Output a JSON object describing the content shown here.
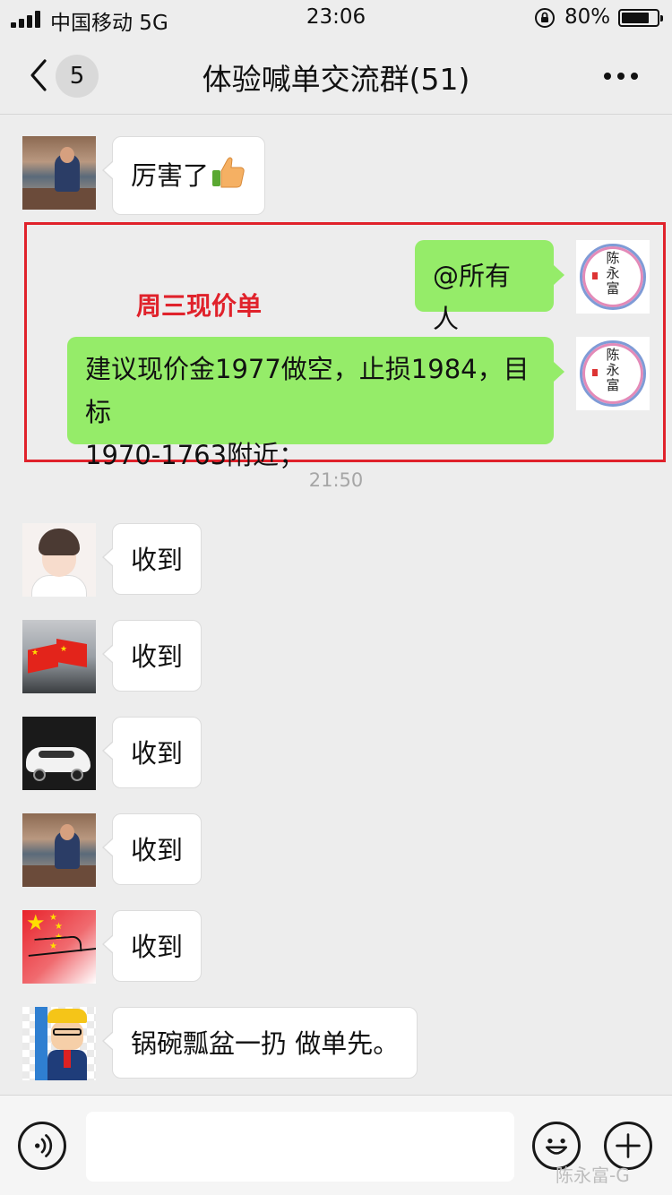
{
  "status_bar": {
    "carrier": "中国移动  5G",
    "time": "23:06",
    "battery_percent": "80%",
    "battery_level": 0.8,
    "icons": [
      "signal-bars-icon",
      "rotation-lock-icon",
      "battery-icon"
    ]
  },
  "nav": {
    "back_icon": "chevron-left-icon",
    "unread_badge": "5",
    "title": "体验喊单交流群(51)",
    "more_icon": "more-dots-icon"
  },
  "messages": [
    {
      "side": "left",
      "text": "厉害了",
      "emoji": "thumbs-up-icon"
    },
    {
      "side": "right",
      "text": "@所有人"
    },
    {
      "side": "right",
      "text_lines": [
        "建议现价金1977做空，止损1984，目标",
        "1970-1763附近；"
      ]
    },
    {
      "side": "left",
      "text": "收到"
    },
    {
      "side": "left",
      "text": "收到"
    },
    {
      "side": "left",
      "text": "收到"
    },
    {
      "side": "left",
      "text": "收到"
    },
    {
      "side": "left",
      "text": "收到"
    },
    {
      "side": "left",
      "text": "锅碗瓢盆一扔 做单先。"
    }
  ],
  "annotation": {
    "label": "周三现价单",
    "color": "#e0222b"
  },
  "chen_avatar_text": "陈永富",
  "timestamp": "21:50",
  "input_bar": {
    "voice_icon": "voice-icon",
    "emoji_icon": "emoji-face-icon",
    "plus_icon": "plus-icon"
  },
  "watermark": "陈永富-G",
  "colors": {
    "background": "#ededed",
    "sent_bubble": "#95ec69",
    "received_bubble": "#ffffff",
    "highlight_box": "#e0222b"
  }
}
